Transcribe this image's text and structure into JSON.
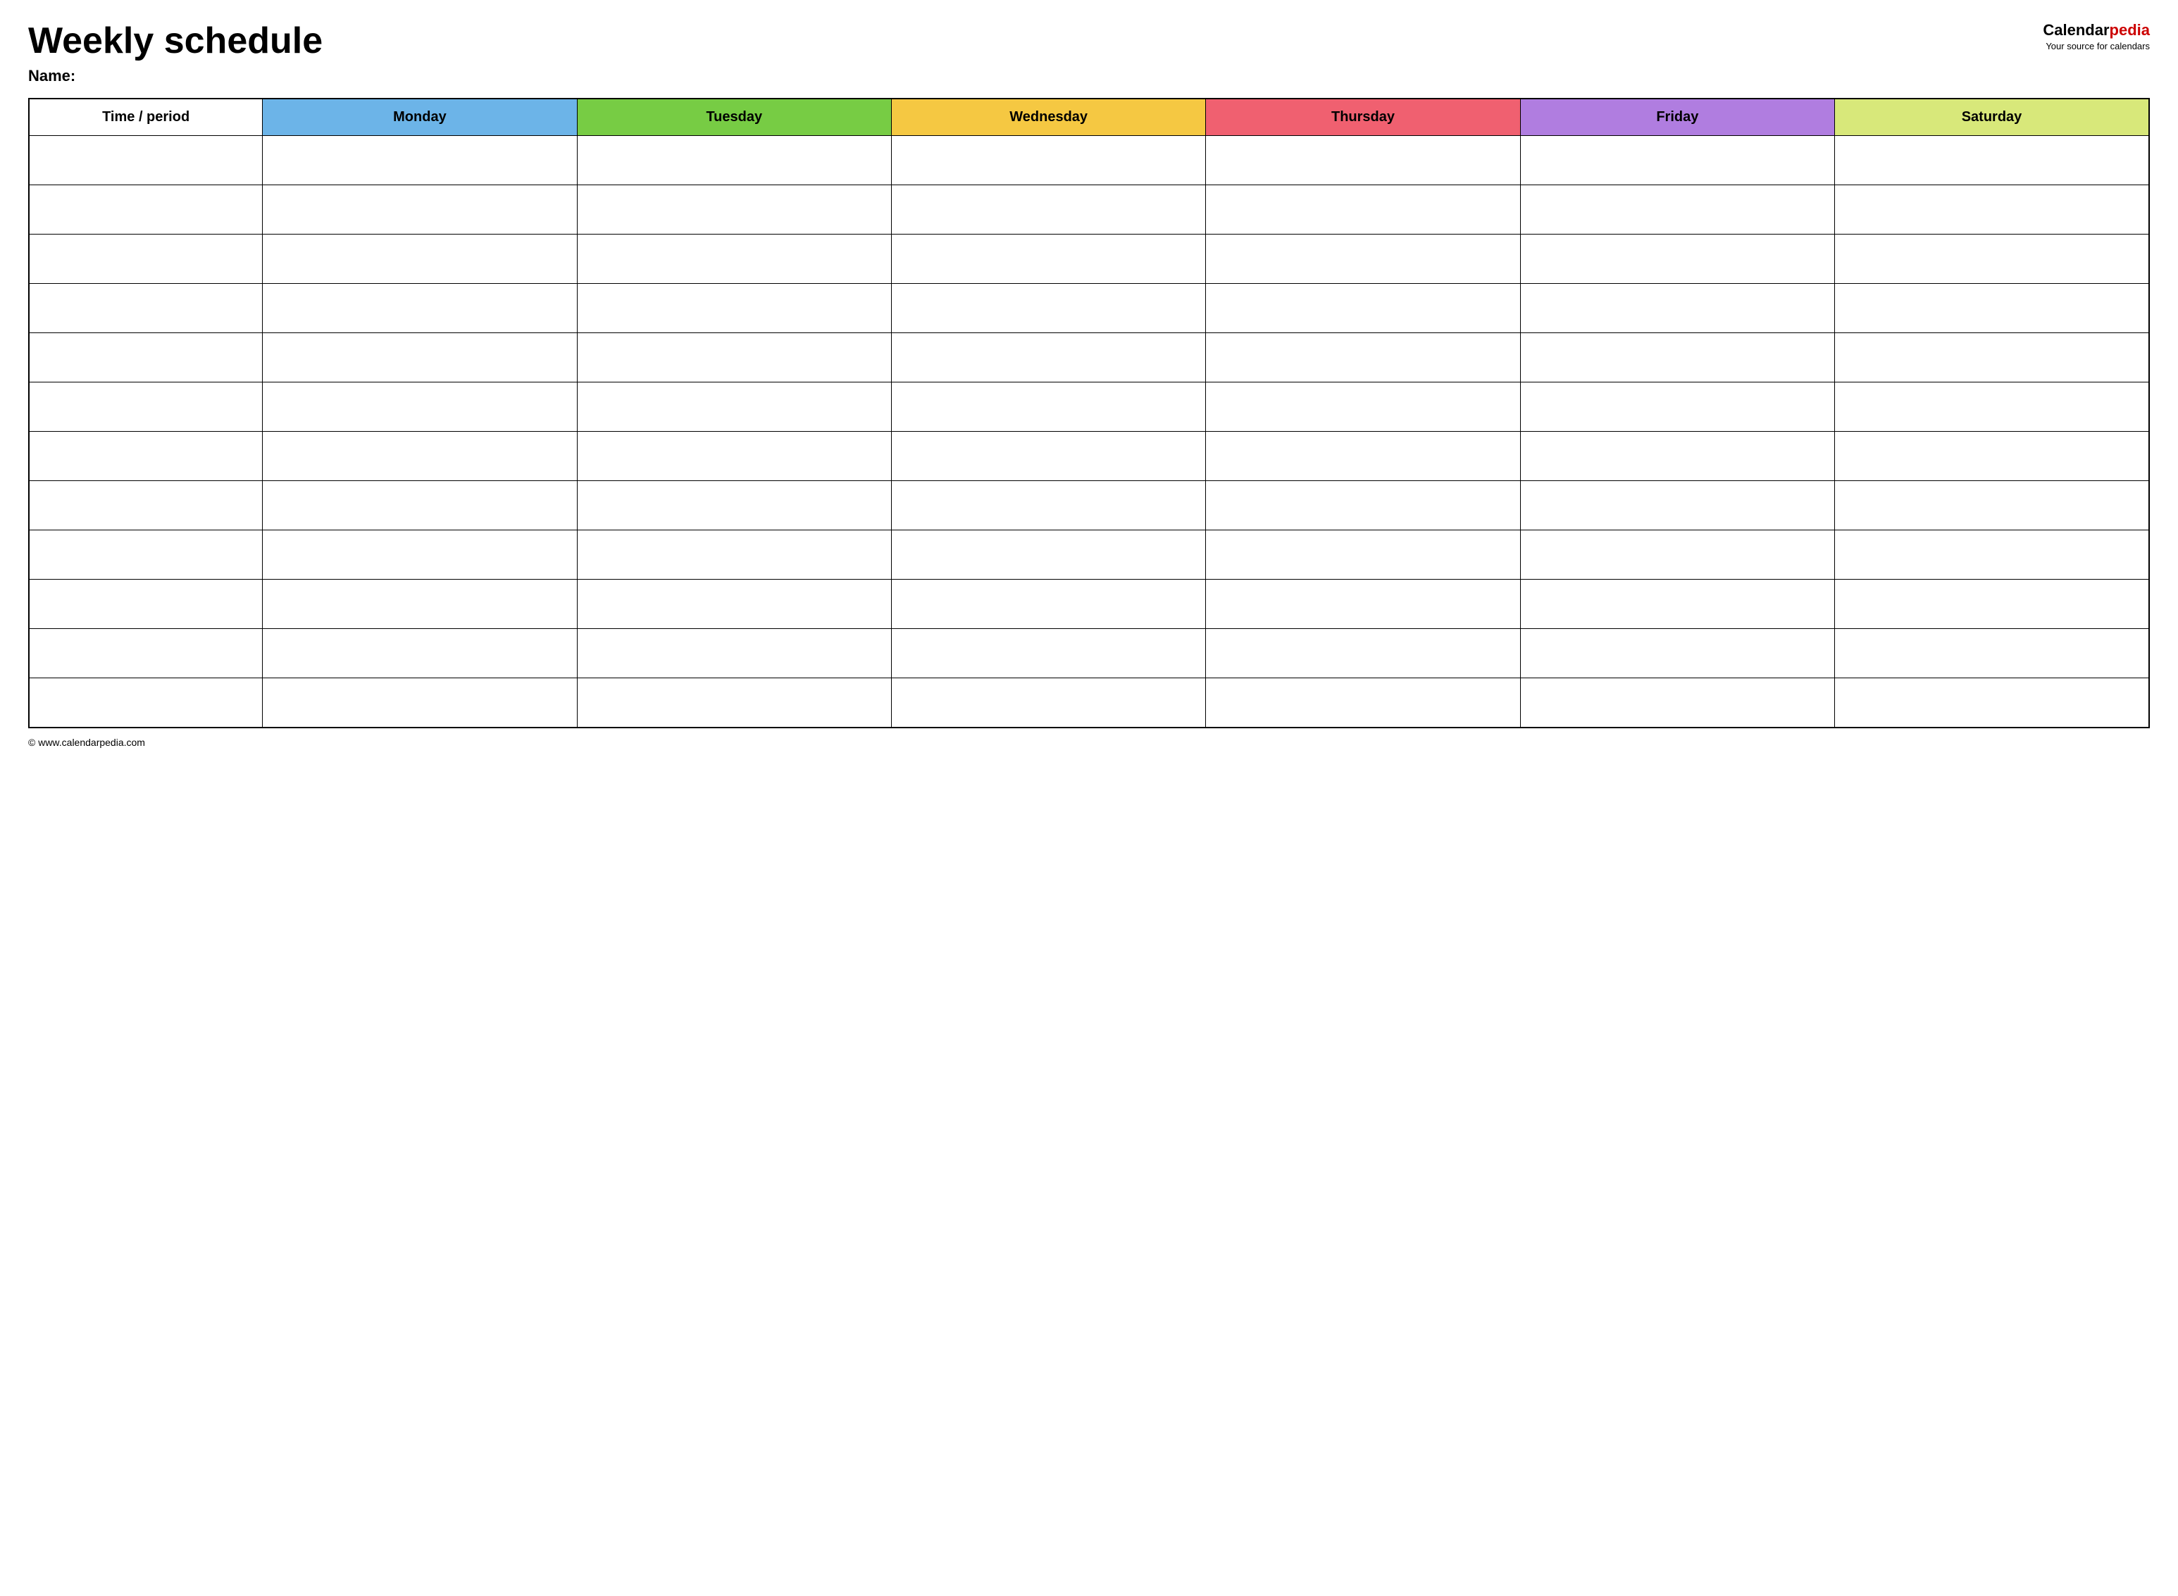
{
  "header": {
    "title": "Weekly schedule",
    "name_label": "Name:",
    "logo_calendar": "Calendar",
    "logo_pedia": "pedia",
    "logo_tagline": "Your source for calendars"
  },
  "table": {
    "columns": [
      {
        "key": "time",
        "label": "Time / period",
        "color": "#ffffff",
        "class": "col-time"
      },
      {
        "key": "monday",
        "label": "Monday",
        "color": "#6cb4e8",
        "class": "col-monday"
      },
      {
        "key": "tuesday",
        "label": "Tuesday",
        "color": "#77cc44",
        "class": "col-tuesday"
      },
      {
        "key": "wednesday",
        "label": "Wednesday",
        "color": "#f5c842",
        "class": "col-wednesday"
      },
      {
        "key": "thursday",
        "label": "Thursday",
        "color": "#f06070",
        "class": "col-thursday"
      },
      {
        "key": "friday",
        "label": "Friday",
        "color": "#b07de0",
        "class": "col-friday"
      },
      {
        "key": "saturday",
        "label": "Saturday",
        "color": "#d8e87a",
        "class": "col-saturday"
      }
    ],
    "row_count": 12
  },
  "footer": {
    "url": "© www.calendarpedia.com"
  }
}
